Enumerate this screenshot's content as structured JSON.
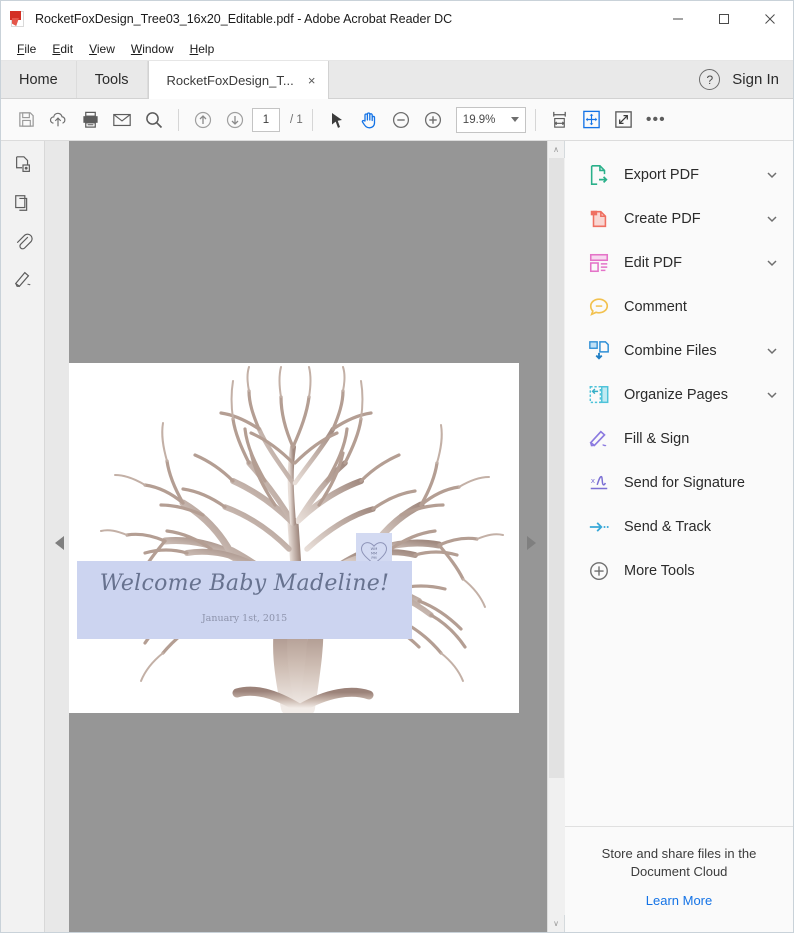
{
  "window": {
    "title": "RocketFoxDesign_Tree03_16x20_Editable.pdf - Adobe Acrobat Reader DC",
    "app_icon": "adobe-acrobat-icon",
    "minimize": "–",
    "maximize": "☐",
    "close": "×"
  },
  "menu": {
    "items": [
      {
        "accel": "F",
        "rest": "ile"
      },
      {
        "accel": "E",
        "rest": "dit"
      },
      {
        "accel": "V",
        "rest": "iew"
      },
      {
        "accel": "W",
        "rest": "indow"
      },
      {
        "accel": "H",
        "rest": "elp"
      }
    ]
  },
  "tabs": {
    "home": "Home",
    "tools": "Tools",
    "document": "RocketFoxDesign_T...",
    "close_glyph": "×",
    "help_glyph": "?",
    "sign_in": "Sign In"
  },
  "toolbar": {
    "save": "save-icon",
    "upload_cloud": "upload-to-cloud-icon",
    "print": "print-icon",
    "email": "email-icon",
    "search": "search-icon",
    "previous_page": "previous-page-icon",
    "next_page": "next-page-icon",
    "page_number": "1",
    "page_total": "/ 1",
    "select_tool": "select-cursor-icon",
    "hand_tool": "hand-tool-icon",
    "zoom_out": "zoom-out-icon",
    "zoom_in": "zoom-in-icon",
    "zoom_level": "19.9%",
    "fit_width": "fit-width-icon",
    "fit_page": "fit-page-icon",
    "full_screen": "full-screen-icon",
    "more": "•••"
  },
  "left_rail": {
    "items": [
      {
        "name": "page-thumbnails-icon"
      },
      {
        "name": "bookmarks-pages-icon"
      },
      {
        "name": "attachments-paperclip-icon"
      },
      {
        "name": "signatures-pen-icon"
      }
    ]
  },
  "viewer": {
    "prev_page_arrow": "previous-page-arrow",
    "next_page_arrow": "next-page-arrow",
    "scroll_up": "∧",
    "scroll_down": "∨",
    "background_color": "#969696",
    "page_color": "#ffffff"
  },
  "document": {
    "banner_color": "#ccd4f0",
    "title": "Welcome Baby Madeline!",
    "date": "January 1st, 2015",
    "trunk_heart": "heart-with-initials",
    "heart_lines": [
      "WM",
      "MM",
      "PM"
    ],
    "tree_color": "#9b8279"
  },
  "tools_panel": {
    "items": [
      {
        "label": "Export PDF",
        "icon": "export-pdf-icon",
        "color": "#2ab08a",
        "caret": true
      },
      {
        "label": "Create PDF",
        "icon": "create-pdf-icon",
        "color": "#ef6f61",
        "caret": true
      },
      {
        "label": "Edit PDF",
        "icon": "edit-pdf-icon",
        "color": "#e473c8",
        "caret": true
      },
      {
        "label": "Comment",
        "icon": "comment-icon",
        "color": "#f2c14e",
        "caret": false
      },
      {
        "label": "Combine Files",
        "icon": "combine-files-icon",
        "color": "#2e8fd6",
        "caret": true
      },
      {
        "label": "Organize Pages",
        "icon": "organize-pages-icon",
        "color": "#4ec3d9",
        "caret": true
      },
      {
        "label": "Fill & Sign",
        "icon": "fill-and-sign-icon",
        "color": "#8b7ae0",
        "caret": false
      },
      {
        "label": "Send for Signature",
        "icon": "send-for-signature-icon",
        "color": "#7b6fd4",
        "caret": false
      },
      {
        "label": "Send & Track",
        "icon": "send-and-track-icon",
        "color": "#38a8d8",
        "caret": false
      },
      {
        "label": "More Tools",
        "icon": "more-tools-plus-icon",
        "color": "#6e6e6e",
        "caret": false
      }
    ],
    "footer_line1": "Store and share files in the",
    "footer_line2": "Document Cloud",
    "footer_link": "Learn More"
  }
}
